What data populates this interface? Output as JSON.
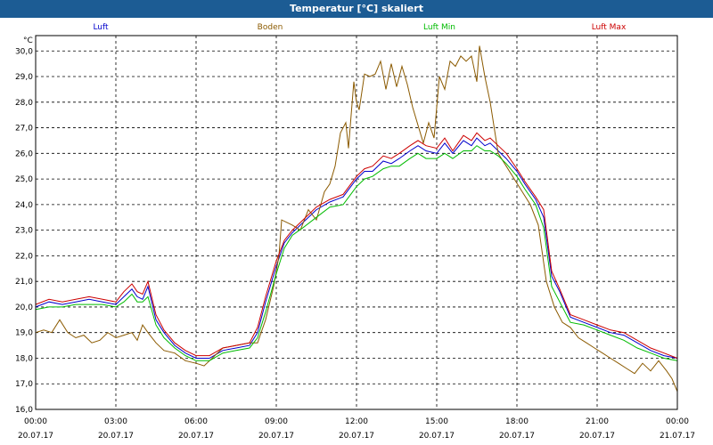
{
  "window": {
    "title": "Temperatur [°C] skaliert"
  },
  "colors": {
    "titlebar": "#1c5c94",
    "background": "#ffffff",
    "grid": "#000000"
  },
  "chart_data": {
    "type": "line",
    "title": "Temperatur [°C] skaliert",
    "ylabel": "°C",
    "xlabel": "",
    "ylim": [
      16.0,
      30.6
    ],
    "xlim": [
      0,
      24
    ],
    "y_ticks": [
      "16,0",
      "17,0",
      "18,0",
      "19,0",
      "20,0",
      "21,0",
      "22,0",
      "23,0",
      "24,0",
      "25,0",
      "26,0",
      "27,0",
      "28,0",
      "29,0",
      "30,0"
    ],
    "x_ticks": [
      {
        "time": "00:00",
        "date": "20.07.17"
      },
      {
        "time": "03:00",
        "date": "20.07.17"
      },
      {
        "time": "06:00",
        "date": "20.07.17"
      },
      {
        "time": "09:00",
        "date": "20.07.17"
      },
      {
        "time": "12:00",
        "date": "20.07.17"
      },
      {
        "time": "15:00",
        "date": "20.07.17"
      },
      {
        "time": "18:00",
        "date": "20.07.17"
      },
      {
        "time": "21:00",
        "date": "20.07.17"
      },
      {
        "time": "00:00",
        "date": "21.07.17"
      }
    ],
    "grid": true,
    "legend_position": "top",
    "series": [
      {
        "name": "Luft",
        "color": "#0000cc",
        "x": [
          0,
          0.5,
          1,
          1.5,
          2,
          2.5,
          3,
          3.3,
          3.6,
          3.8,
          4,
          4.2,
          4.5,
          4.8,
          5.2,
          5.6,
          6,
          6.5,
          7,
          7.5,
          8,
          8.3,
          8.6,
          9,
          9.3,
          9.6,
          10,
          10.5,
          11,
          11.5,
          12,
          12.3,
          12.6,
          13,
          13.3,
          13.6,
          14,
          14.3,
          14.6,
          15,
          15.3,
          15.6,
          16,
          16.3,
          16.5,
          16.8,
          17,
          17.3,
          17.6,
          18,
          18.3,
          18.7,
          19,
          19.3,
          19.6,
          20,
          20.5,
          21,
          21.5,
          22,
          22.5,
          23,
          23.5,
          24
        ],
        "y": [
          20.0,
          20.2,
          20.1,
          20.2,
          20.3,
          20.2,
          20.1,
          20.4,
          20.7,
          20.4,
          20.3,
          20.8,
          19.5,
          19.0,
          18.5,
          18.2,
          18.0,
          18.0,
          18.3,
          18.4,
          18.5,
          19.0,
          20.2,
          21.6,
          22.5,
          22.9,
          23.3,
          23.8,
          24.1,
          24.3,
          25.0,
          25.3,
          25.3,
          25.7,
          25.6,
          25.8,
          26.1,
          26.3,
          26.1,
          26.0,
          26.4,
          26.0,
          26.5,
          26.3,
          26.6,
          26.3,
          26.4,
          26.1,
          25.8,
          25.3,
          24.8,
          24.2,
          23.5,
          21.2,
          20.6,
          19.6,
          19.4,
          19.2,
          19.0,
          18.9,
          18.6,
          18.3,
          18.1,
          18.0
        ]
      },
      {
        "name": "Boden",
        "color": "#8b5a00",
        "x": [
          0,
          0.3,
          0.6,
          0.9,
          1.2,
          1.5,
          1.8,
          2.1,
          2.4,
          2.7,
          3,
          3.3,
          3.6,
          3.8,
          4,
          4.2,
          4.5,
          4.8,
          5.2,
          5.6,
          6,
          6.3,
          6.6,
          7,
          7.5,
          8,
          8.3,
          8.6,
          8.9,
          9.1,
          9.2,
          9.6,
          9.9,
          10.2,
          10.5,
          10.8,
          11,
          11.2,
          11.4,
          11.6,
          11.7,
          11.9,
          12,
          12.1,
          12.3,
          12.5,
          12.7,
          12.9,
          13.1,
          13.3,
          13.5,
          13.7,
          13.9,
          14.1,
          14.3,
          14.5,
          14.7,
          14.9,
          15.1,
          15.3,
          15.5,
          15.7,
          15.9,
          16.1,
          16.3,
          16.5,
          16.6,
          16.8,
          17,
          17.3,
          17.6,
          17.9,
          18.2,
          18.5,
          18.8,
          19.1,
          19.4,
          19.7,
          20,
          20.3,
          20.6,
          20.9,
          21.2,
          21.5,
          21.8,
          22.1,
          22.4,
          22.7,
          23,
          23.3,
          23.6,
          23.8,
          24
        ],
        "y": [
          19.0,
          19.1,
          19.0,
          19.5,
          19.0,
          18.8,
          18.9,
          18.6,
          18.7,
          19.0,
          18.8,
          18.9,
          19.0,
          18.7,
          19.3,
          19.0,
          18.6,
          18.3,
          18.2,
          17.9,
          17.8,
          17.7,
          18.0,
          18.4,
          18.5,
          18.6,
          18.6,
          19.5,
          20.8,
          22.0,
          23.4,
          23.2,
          23.0,
          23.8,
          23.4,
          24.5,
          24.8,
          25.5,
          26.8,
          27.2,
          26.2,
          28.8,
          28.0,
          27.7,
          29.1,
          29.0,
          29.1,
          29.6,
          28.5,
          29.5,
          28.6,
          29.4,
          28.7,
          27.8,
          27.1,
          26.4,
          27.2,
          26.6,
          29.0,
          28.5,
          29.6,
          29.4,
          29.8,
          29.6,
          29.8,
          28.8,
          30.2,
          29.0,
          28.0,
          26.0,
          25.5,
          25.0,
          24.5,
          24.0,
          23.2,
          21.0,
          20.0,
          19.4,
          19.2,
          18.8,
          18.6,
          18.4,
          18.2,
          18.0,
          17.8,
          17.6,
          17.4,
          17.8,
          17.5,
          17.9,
          17.5,
          17.2,
          16.7
        ]
      },
      {
        "name": "Luft Min",
        "color": "#00bb00",
        "x": [
          0,
          0.5,
          1,
          1.5,
          2,
          2.5,
          3,
          3.3,
          3.6,
          3.8,
          4,
          4.2,
          4.5,
          4.8,
          5.2,
          5.6,
          6,
          6.5,
          7,
          7.5,
          8,
          8.3,
          8.6,
          9,
          9.3,
          9.6,
          10,
          10.5,
          11,
          11.5,
          12,
          12.3,
          12.6,
          13,
          13.3,
          13.6,
          14,
          14.3,
          14.6,
          15,
          15.3,
          15.6,
          16,
          16.3,
          16.5,
          16.8,
          17,
          17.3,
          17.6,
          18,
          18.3,
          18.7,
          19,
          19.3,
          19.6,
          20,
          20.5,
          21,
          21.5,
          22,
          22.5,
          23,
          23.5,
          24
        ],
        "y": [
          19.9,
          20.0,
          20.0,
          20.1,
          20.1,
          20.1,
          20.0,
          20.2,
          20.5,
          20.2,
          20.2,
          20.4,
          19.3,
          18.8,
          18.4,
          18.1,
          17.9,
          17.9,
          18.2,
          18.3,
          18.4,
          18.8,
          19.8,
          21.3,
          22.3,
          22.8,
          23.1,
          23.5,
          23.9,
          24.0,
          24.7,
          25.0,
          25.1,
          25.4,
          25.5,
          25.5,
          25.8,
          26.0,
          25.8,
          25.8,
          26.0,
          25.8,
          26.1,
          26.1,
          26.3,
          26.1,
          26.1,
          25.9,
          25.6,
          25.1,
          24.6,
          24.0,
          23.1,
          20.8,
          20.2,
          19.4,
          19.3,
          19.1,
          18.9,
          18.7,
          18.4,
          18.2,
          18.0,
          17.9
        ]
      },
      {
        "name": "Luft Max",
        "color": "#cc0000",
        "x": [
          0,
          0.5,
          1,
          1.5,
          2,
          2.5,
          3,
          3.3,
          3.6,
          3.8,
          4,
          4.2,
          4.5,
          4.8,
          5.2,
          5.6,
          6,
          6.5,
          7,
          7.5,
          8,
          8.3,
          8.6,
          9,
          9.3,
          9.6,
          10,
          10.5,
          11,
          11.5,
          12,
          12.3,
          12.6,
          13,
          13.3,
          13.6,
          14,
          14.3,
          14.6,
          15,
          15.3,
          15.6,
          16,
          16.3,
          16.5,
          16.8,
          17,
          17.3,
          17.6,
          18,
          18.3,
          18.7,
          19,
          19.3,
          19.6,
          20,
          20.5,
          21,
          21.5,
          22,
          22.5,
          23,
          23.5,
          24
        ],
        "y": [
          20.1,
          20.3,
          20.2,
          20.3,
          20.4,
          20.3,
          20.2,
          20.6,
          20.9,
          20.6,
          20.5,
          21.0,
          19.7,
          19.1,
          18.6,
          18.3,
          18.1,
          18.1,
          18.4,
          18.5,
          18.6,
          19.2,
          20.4,
          21.8,
          22.6,
          23.0,
          23.4,
          23.9,
          24.2,
          24.4,
          25.1,
          25.4,
          25.5,
          25.9,
          25.8,
          26.0,
          26.3,
          26.5,
          26.3,
          26.2,
          26.6,
          26.1,
          26.7,
          26.5,
          26.8,
          26.5,
          26.6,
          26.3,
          26.0,
          25.4,
          24.9,
          24.3,
          23.8,
          21.4,
          20.7,
          19.7,
          19.5,
          19.3,
          19.1,
          19.0,
          18.7,
          18.4,
          18.2,
          18.0
        ]
      }
    ]
  }
}
